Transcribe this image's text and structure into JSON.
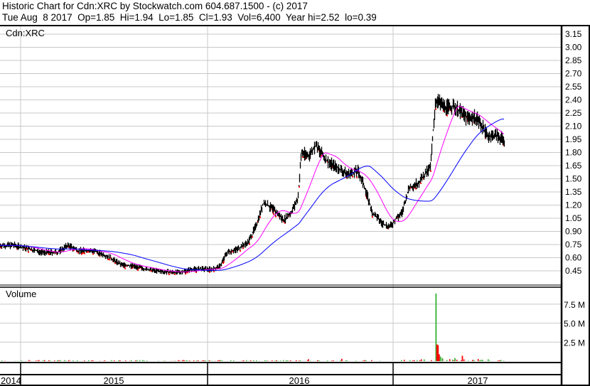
{
  "header": {
    "line1": "Historic Chart for Cdn:XRC by Stockwatch.com 604.687.1500 - (c) 2017",
    "line2": "Tue Aug  8 2017  Op=1.85  Hi=1.94  Lo=1.85  Cl=1.93  Vol=6,400  Year hi=2.52  lo=0.39"
  },
  "colors": {
    "price": "#000000",
    "down_tick": "#ff0000",
    "ma_short": "#ff00ff",
    "ma_long": "#0000ff",
    "vol_up": "#33b333",
    "vol_down": "#ff0000",
    "grid": "#c8c8c8"
  },
  "chart_data": {
    "type": "line",
    "title": "Cdn:XRC",
    "price_axis": {
      "ylim": [
        0.39,
        3.2
      ],
      "ticks": [
        "3.15",
        "3.00",
        "2.85",
        "2.70",
        "2.55",
        "2.40",
        "2.25",
        "2.10",
        "1.95",
        "1.80",
        "1.65",
        "1.50",
        "1.35",
        "1.20",
        "1.05",
        "0.90",
        "0.75",
        "0.60",
        "0.45"
      ]
    },
    "x_axis": {
      "labels": [
        "2014",
        "2015",
        "2016",
        "2017"
      ],
      "range": [
        2014.89,
        2017.6
      ]
    },
    "close": [
      [
        2014.889,
        0.74
      ],
      [
        2014.966,
        0.74
      ],
      [
        2015.042,
        0.7
      ],
      [
        2015.118,
        0.66
      ],
      [
        2015.195,
        0.66
      ],
      [
        2015.252,
        0.74
      ],
      [
        2015.309,
        0.68
      ],
      [
        2015.385,
        0.68
      ],
      [
        2015.462,
        0.62
      ],
      [
        2015.538,
        0.52
      ],
      [
        2015.615,
        0.5
      ],
      [
        2015.691,
        0.46
      ],
      [
        2015.767,
        0.44
      ],
      [
        2015.844,
        0.43
      ],
      [
        2015.92,
        0.47
      ],
      [
        2015.996,
        0.47
      ],
      [
        2016.03,
        0.47
      ],
      [
        2016.068,
        0.5
      ],
      [
        2016.106,
        0.66
      ],
      [
        2016.163,
        0.7
      ],
      [
        2016.221,
        0.78
      ],
      [
        2016.259,
        0.95
      ],
      [
        2016.304,
        1.23
      ],
      [
        2016.354,
        1.15
      ],
      [
        2016.411,
        1.03
      ],
      [
        2016.449,
        1.11
      ],
      [
        2016.487,
        1.27
      ],
      [
        2016.506,
        1.8
      ],
      [
        2016.544,
        1.76
      ],
      [
        2016.582,
        1.88
      ],
      [
        2016.639,
        1.71
      ],
      [
        2016.696,
        1.63
      ],
      [
        2016.753,
        1.55
      ],
      [
        2016.81,
        1.59
      ],
      [
        2016.848,
        1.39
      ],
      [
        2016.886,
        1.11
      ],
      [
        2016.943,
        0.99
      ],
      [
        2016.981,
        0.95
      ],
      [
        2017.008,
        1.03
      ],
      [
        2017.046,
        1.11
      ],
      [
        2017.084,
        1.39
      ],
      [
        2017.142,
        1.47
      ],
      [
        2017.199,
        1.63
      ],
      [
        2017.226,
        2.4
      ],
      [
        2017.276,
        2.32
      ],
      [
        2017.333,
        2.32
      ],
      [
        2017.391,
        2.2
      ],
      [
        2017.448,
        2.2
      ],
      [
        2017.506,
        1.99
      ],
      [
        2017.563,
        1.99
      ],
      [
        2017.6,
        1.92
      ]
    ],
    "moving_averages": [
      {
        "name": "short",
        "window_days": 50
      },
      {
        "name": "long",
        "window_days": 140
      }
    ],
    "volume": {
      "label": "Volume",
      "ticks": [
        "7.5 M",
        "5.0 M",
        "2.5 M"
      ],
      "tick_values": [
        7500000,
        5000000,
        2500000
      ],
      "ylim": [
        0,
        10000000
      ],
      "spikes": [
        [
          2017.228,
          8900000,
          "up"
        ],
        [
          2017.233,
          2200000,
          "down"
        ],
        [
          2017.239,
          2100000,
          "down"
        ],
        [
          2017.245,
          900000,
          "down"
        ],
        [
          2017.252,
          600000,
          "up"
        ],
        [
          2017.262,
          400000,
          "up"
        ],
        [
          2017.33,
          400000,
          "up"
        ],
        [
          2017.37,
          700000,
          "down"
        ],
        [
          2016.72,
          300000,
          "down"
        ],
        [
          2016.54,
          250000,
          "down"
        ]
      ],
      "typical": 80000
    }
  }
}
